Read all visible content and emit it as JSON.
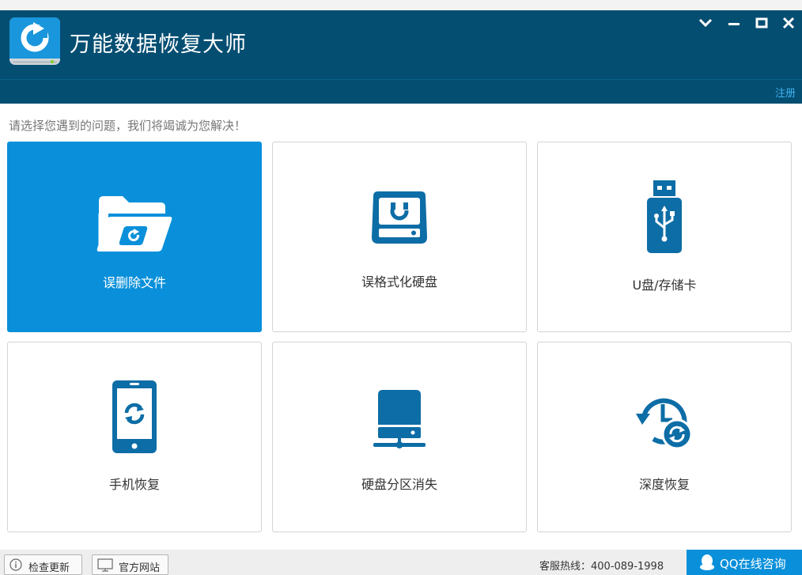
{
  "app": {
    "title": "万能数据恢复大师"
  },
  "header": {
    "register_label": "注册"
  },
  "main": {
    "prompt": "请选择您遇到的问题，我们将竭诚为您解决！",
    "tiles": [
      {
        "label": "误删除文件",
        "icon": "folder-restore-icon",
        "selected": true
      },
      {
        "label": "误格式化硬盘",
        "icon": "hard-drive-icon",
        "selected": false
      },
      {
        "label": "U盘/存储卡",
        "icon": "usb-drive-icon",
        "selected": false
      },
      {
        "label": "手机恢复",
        "icon": "phone-restore-icon",
        "selected": false
      },
      {
        "label": "硬盘分区消失",
        "icon": "network-drive-icon",
        "selected": false
      },
      {
        "label": "深度恢复",
        "icon": "clock-history-icon",
        "selected": false
      }
    ]
  },
  "footer": {
    "check_update": "检查更新",
    "official_site": "官方网站",
    "hotline": "客服热线：400-089-1998",
    "qq_consult": "QQ在线咨询"
  },
  "colors": {
    "titlebar": "#044e72",
    "accent": "#0a90da",
    "icon": "#0d6da6",
    "link": "#3fb3ef"
  }
}
